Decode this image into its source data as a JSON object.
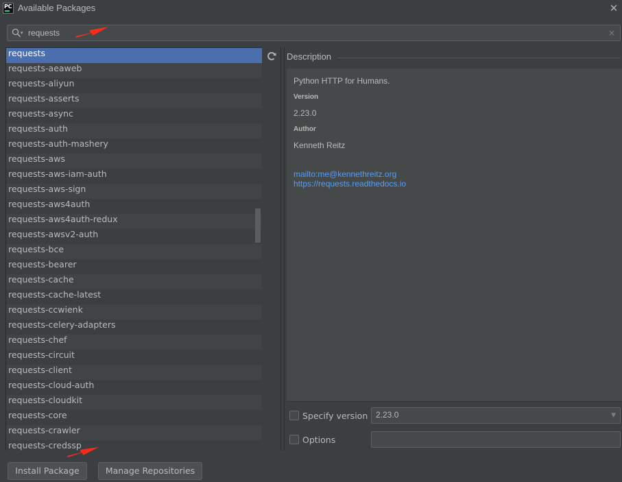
{
  "window": {
    "title": "Available Packages",
    "app_icon_text": "PC",
    "close_glyph": "✕"
  },
  "search": {
    "value": "requests",
    "clear_glyph": "×"
  },
  "packages": [
    "requests",
    "requests-aeaweb",
    "requests-aliyun",
    "requests-asserts",
    "requests-async",
    "requests-auth",
    "requests-auth-mashery",
    "requests-aws",
    "requests-aws-iam-auth",
    "requests-aws-sign",
    "requests-aws4auth",
    "requests-aws4auth-redux",
    "requests-awsv2-auth",
    "requests-bce",
    "requests-bearer",
    "requests-cache",
    "requests-cache-latest",
    "requests-ccwienk",
    "requests-celery-adapters",
    "requests-chef",
    "requests-circuit",
    "requests-client",
    "requests-cloud-auth",
    "requests-cloudkit",
    "requests-core",
    "requests-crawler",
    "requests-credssp"
  ],
  "selected_index": 0,
  "description": {
    "header": "Description",
    "summary": "Python HTTP for Humans.",
    "version_label": "Version",
    "version": "2.23.0",
    "author_label": "Author",
    "author": "Kenneth Reitz",
    "links": [
      "mailto:me@kennethreitz.org",
      "https://requests.readthedocs.io"
    ]
  },
  "options": {
    "specify_version_label": "Specify version",
    "specify_version_value": "2.23.0",
    "options_label": "Options",
    "options_value": ""
  },
  "buttons": {
    "install": "Install Package",
    "manage": "Manage Repositories"
  },
  "colors": {
    "background": "#3c3f41",
    "selection": "#4b6eaf",
    "link": "#589df6",
    "annotation_arrow": "#ff2a1a"
  }
}
